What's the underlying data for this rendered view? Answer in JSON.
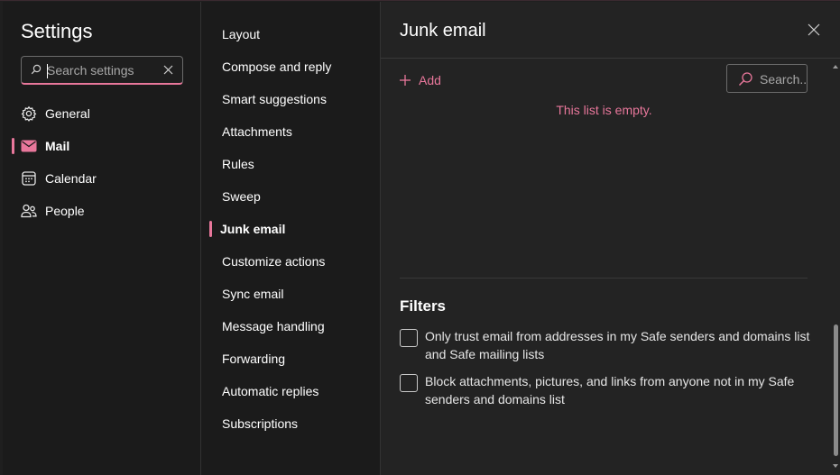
{
  "sidebar": {
    "title": "Settings",
    "search_placeholder": "Search settings",
    "items": [
      {
        "label": "General",
        "icon": "gear-icon"
      },
      {
        "label": "Mail",
        "icon": "mail-icon",
        "active": true
      },
      {
        "label": "Calendar",
        "icon": "calendar-icon"
      },
      {
        "label": "People",
        "icon": "people-icon"
      }
    ]
  },
  "subnav": {
    "items": [
      {
        "label": "Layout"
      },
      {
        "label": "Compose and reply"
      },
      {
        "label": "Smart suggestions"
      },
      {
        "label": "Attachments"
      },
      {
        "label": "Rules"
      },
      {
        "label": "Sweep"
      },
      {
        "label": "Junk email",
        "active": true
      },
      {
        "label": "Customize actions"
      },
      {
        "label": "Sync email"
      },
      {
        "label": "Message handling"
      },
      {
        "label": "Forwarding"
      },
      {
        "label": "Automatic replies"
      },
      {
        "label": "Subscriptions"
      }
    ]
  },
  "main": {
    "title": "Junk email",
    "add_label": "Add",
    "search_placeholder": "Search...",
    "empty_text": "This list is empty.",
    "filters": {
      "title": "Filters",
      "options": [
        {
          "label": "Only trust email from addresses in my Safe senders and domains list and Safe mailing lists",
          "checked": false
        },
        {
          "label": "Block attachments, pictures, and links from anyone not in my Safe senders and domains list",
          "checked": false
        }
      ]
    }
  },
  "colors": {
    "accent": "#e8779b",
    "background": "#1f1f1f",
    "pane": "#1b1b1b",
    "content": "#232323"
  }
}
